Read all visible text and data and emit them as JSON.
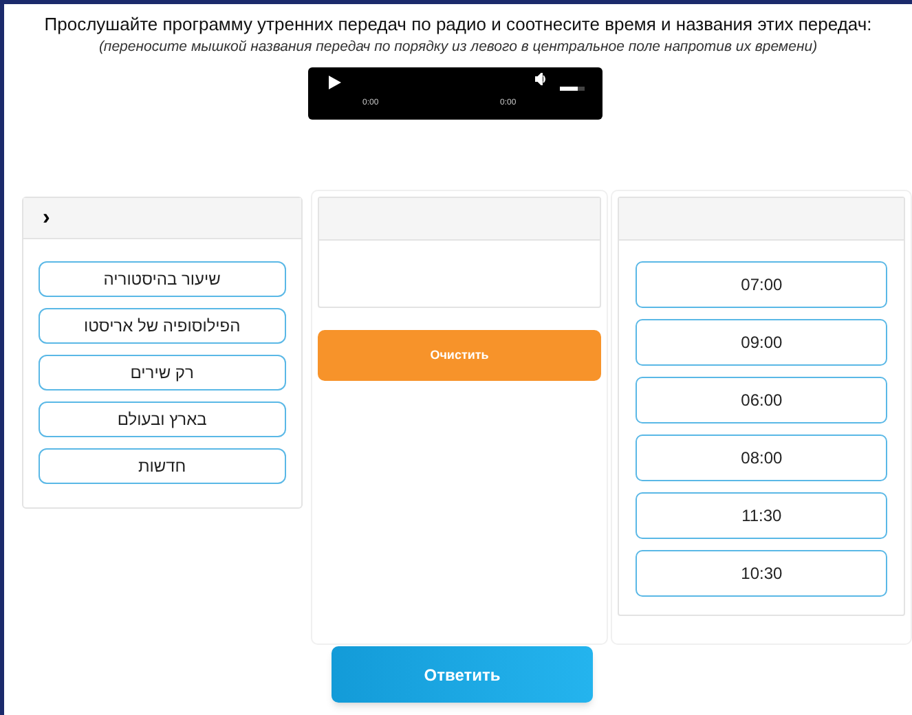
{
  "instruction": "Прослушайте программу утренних передач по радио и соотнесите время и названия этих передач:",
  "hint": "(переносите мышкой названия передач по порядку из левого в центральное поле напротив их времени)",
  "player": {
    "current_time": "0:00",
    "duration": "0:00",
    "level": 0.75
  },
  "source_panel": {
    "toggle": "›",
    "items": [
      "שיעור בהיסטוריה",
      "הפילוסופיה של אריסטו",
      "רק שירים",
      "בארץ ובעולם",
      "חדשות"
    ]
  },
  "clear_button": "Очистить",
  "times": [
    "07:00",
    "09:00",
    "06:00",
    "08:00",
    "11:30",
    "10:30"
  ],
  "submit_button": "Ответить"
}
